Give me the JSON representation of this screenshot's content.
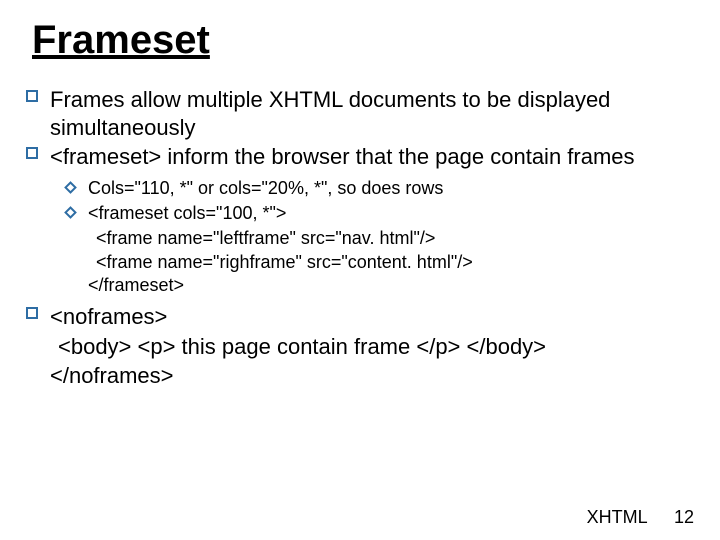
{
  "title": "Frameset",
  "bullets": {
    "b1": "Frames allow multiple XHTML documents to be displayed simultaneously",
    "b2": "<frameset> inform the browser that the page contain frames",
    "sub": {
      "s1": "Cols=\"110, *\" or cols=\"20%, *\", so does rows",
      "s2": "<frameset cols=\"100, *\">",
      "s2a": "<frame name=\"leftframe\" src=\"nav. html\"/>",
      "s2b": "<frame name=\"righframe\" src=\"content. html\"/>",
      "s2c": "</frameset>"
    },
    "b3": "<noframes>",
    "b3a": "<body> <p> this page contain frame </p> </body>",
    "b3b": "</noframes>"
  },
  "footer": {
    "label": "XHTML",
    "page": "12"
  }
}
